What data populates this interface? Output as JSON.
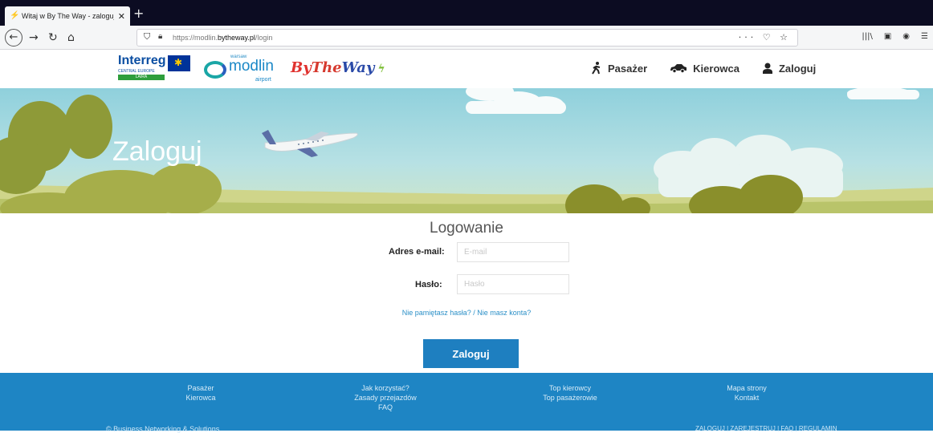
{
  "browser": {
    "tab_title": "Witaj w By The Way - zaloguj si",
    "tab_close": "✕",
    "new_tab": "+",
    "url_prefix": "https://modlin.",
    "url_domain": "bytheway.pl",
    "url_path": "/login",
    "url_tools": "··· ♡ ☆",
    "toolbar_icons": [
      "library-icon",
      "sidebar-icon",
      "account-icon",
      "menu-icon"
    ]
  },
  "header": {
    "logos": {
      "interreg": "Interreg",
      "interreg_sub": "CENTRAL EUROPE",
      "interreg_bar": "LAIRA",
      "modlin_warsaw": "warsaw",
      "modlin": "modlin",
      "modlin_airport": "airport",
      "bytheway_by": "By",
      "bytheway_the": "The",
      "bytheway_way": "Way"
    },
    "nav": [
      {
        "label": "Pasażer",
        "icon": "walking-person-icon"
      },
      {
        "label": "Kierowca",
        "icon": "car-icon"
      },
      {
        "label": "Zaloguj",
        "icon": "user-icon"
      }
    ]
  },
  "hero": {
    "title": "Zaloguj"
  },
  "login": {
    "title": "Logowanie",
    "email_label": "Adres e-mail:",
    "email_placeholder": "E-mail",
    "email_value": "",
    "password_label": "Hasło:",
    "password_placeholder": "Hasło",
    "password_value": "",
    "forgot_password": "Nie pamiętasz hasła?",
    "separator": " / ",
    "no_account": "Nie masz konta?",
    "button": "Zaloguj"
  },
  "footer": {
    "col1": [
      "Pasażer",
      "Kierowca"
    ],
    "col2": [
      "Jak korzystać?",
      "Zasady przejazdów",
      "FAQ"
    ],
    "col3": [
      "Top kierowcy",
      "Top pasażerowie"
    ],
    "col4": [
      "Mapa strony",
      "Kontakt"
    ],
    "copyright": "© Business Networking & Solutions",
    "bottom_links": "ZALOGUJ | ZAREJESTRUJ | FAQ | REGULAMIN"
  },
  "colors": {
    "footer": "#1e85c4",
    "button": "#1e7fc0",
    "link": "#2a8fc7",
    "tabbar": "#0c0c22"
  }
}
